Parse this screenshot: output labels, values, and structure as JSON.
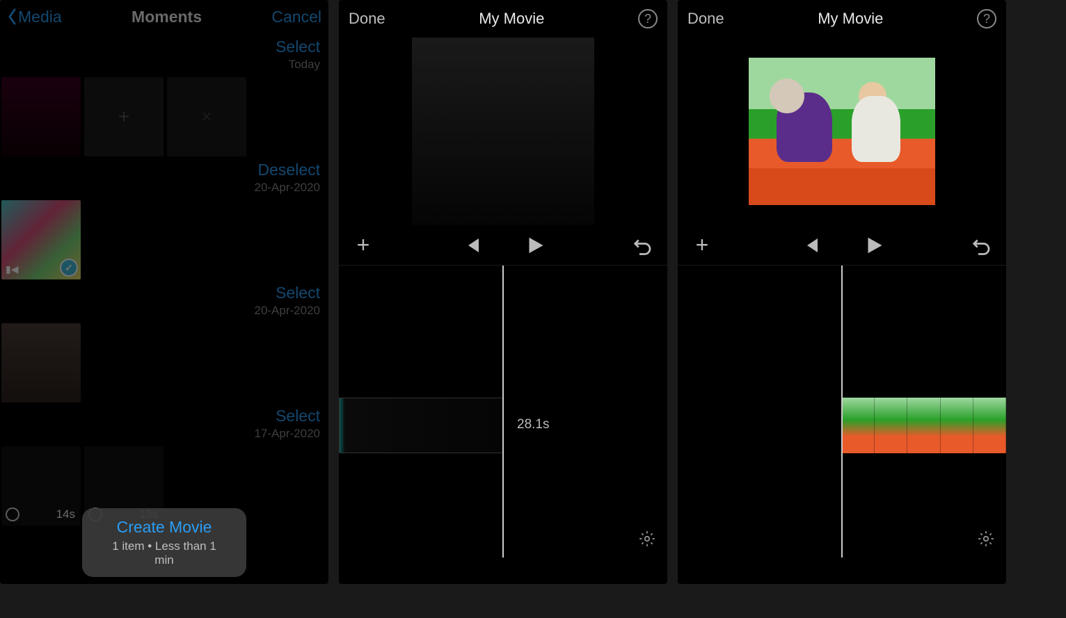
{
  "screen1": {
    "header": {
      "back": "Media",
      "title": "Moments",
      "cancel": "Cancel"
    },
    "sections": [
      {
        "action": "Select",
        "date": "Today"
      },
      {
        "action": "Deselect",
        "date": "20-Apr-2020"
      },
      {
        "action": "Select",
        "date": "20-Apr-2020"
      },
      {
        "action": "Select",
        "date": "17-Apr-2020"
      }
    ],
    "durations": {
      "a": "14s",
      "b": "13s"
    },
    "create": {
      "label": "Create Movie",
      "sub": "1 item • Less than 1 min"
    }
  },
  "screen2": {
    "header": {
      "done": "Done",
      "title": "My Movie"
    },
    "timecode": "28.1s"
  },
  "screen3": {
    "header": {
      "done": "Done",
      "title": "My Movie"
    }
  }
}
